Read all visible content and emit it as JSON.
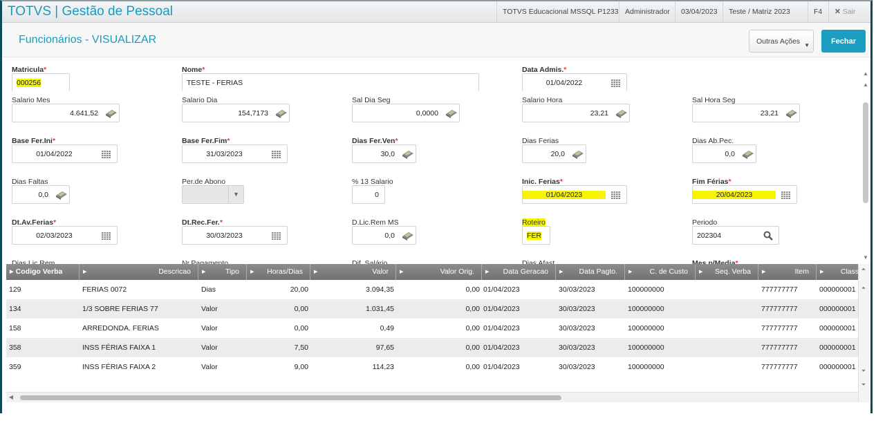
{
  "app": {
    "title": "TOTVS | Gestão de Pessoal",
    "environment": "TOTVS Educacional MSSQL P1233",
    "user": "Administrador",
    "date": "03/04/2023",
    "company": "Teste / Matriz 2023",
    "shortcut": "F4",
    "exit_label": "Sair"
  },
  "page": {
    "title": "Funcionários - VISUALIZAR",
    "other_actions": "Outras Ações",
    "close": "Fechar"
  },
  "fields": [
    {
      "label": "Matricula",
      "required": true,
      "value": "000256",
      "type": "txt",
      "highlight": true
    },
    {
      "label": "Nome",
      "required": true,
      "value": "TESTE - FERIAS",
      "type": "txt"
    },
    {
      "label": "Data Admis.",
      "required": true,
      "value": "01/04/2022",
      "type": "date"
    },
    {
      "label": "Salario Mes",
      "value": "4.641,52",
      "type": "num"
    },
    {
      "label": "Salario Dia",
      "value": "154,7173",
      "type": "num"
    },
    {
      "label": "Sal Dia Seg",
      "value": "0,0000",
      "type": "num"
    },
    {
      "label": "Salario Hora",
      "value": "23,21",
      "type": "num"
    },
    {
      "label": "Sal Hora Seg",
      "value": "23,21",
      "type": "num"
    },
    {
      "label": "Base Fer.Ini",
      "required": true,
      "value": "01/04/2022",
      "type": "date"
    },
    {
      "label": "Base Fer.Fim",
      "required": true,
      "value": "31/03/2023",
      "type": "date"
    },
    {
      "label": "Dias Fer.Ven",
      "required": true,
      "value": "30,0",
      "type": "num"
    },
    {
      "label": "Dias Ferias",
      "value": "20,0",
      "type": "num"
    },
    {
      "label": "Dias Ab.Pec.",
      "value": "0,0",
      "type": "num"
    },
    {
      "label": "Dias Faltas",
      "value": "0,0",
      "type": "num"
    },
    {
      "label": "Per.de Abono",
      "value": "",
      "type": "select",
      "disabled": true
    },
    {
      "label": "% 13 Salario",
      "value": "0",
      "type": "plain"
    },
    {
      "label": "Inic. Ferias",
      "required": true,
      "value": "01/04/2023",
      "type": "date",
      "highlight": true
    },
    {
      "label": "Fim Férias",
      "required": true,
      "value": "20/04/2023",
      "type": "date",
      "highlight": true
    },
    {
      "label": "Dt.Av.Ferias",
      "required": true,
      "value": "02/03/2023",
      "type": "date"
    },
    {
      "label": "Dt.Rec.Fer.",
      "required": true,
      "value": "30/03/2023",
      "type": "date"
    },
    {
      "label": "D.Lic.Rem MS",
      "value": "0,0",
      "type": "num"
    },
    {
      "label": "Roteiro",
      "value": "FER",
      "type": "txt",
      "highlight": true,
      "label_highlight": true
    },
    {
      "label": "Periodo",
      "value": "202304",
      "type": "search"
    }
  ],
  "partial_labels": [
    {
      "label": "Dias Lic.Rem"
    },
    {
      "label": "Nr.Pagamento"
    },
    {
      "label": "Dif. Salário"
    },
    {
      "label": "Dias Afast"
    },
    {
      "label": "Mes p/Media",
      "required": true
    }
  ],
  "grid": {
    "columns": [
      "Codigo Verba",
      "Descricao",
      "Tipo",
      "Horas/Dias",
      "Valor",
      "Valor Orig.",
      "Data Geracao",
      "Data Pagto.",
      "C. de Custo",
      "Seq. Verba",
      "Item",
      "Classe"
    ],
    "rows": [
      [
        "129",
        "FERIAS 0072",
        "Dias",
        "20,00",
        "3.094,35",
        "0,00",
        "01/04/2023",
        "30/03/2023",
        "100000000",
        "",
        "777777777",
        "000000001"
      ],
      [
        "134",
        "1/3 SOBRE FERIAS 77",
        "Valor",
        "0,00",
        "1.031,45",
        "0,00",
        "01/04/2023",
        "30/03/2023",
        "100000000",
        "",
        "777777777",
        "000000001"
      ],
      [
        "158",
        "ARREDONDA. FERIAS",
        "Valor",
        "0,00",
        "0,49",
        "0,00",
        "01/04/2023",
        "30/03/2023",
        "100000000",
        "",
        "777777777",
        "000000001"
      ],
      [
        "358",
        "INSS FÉRIAS FAIXA 1",
        "Valor",
        "7,50",
        "97,65",
        "0,00",
        "01/04/2023",
        "30/03/2023",
        "100000000",
        "",
        "777777777",
        "000000001"
      ],
      [
        "359",
        "INSS FÉRIAS FAIXA 2",
        "Valor",
        "9,00",
        "114,23",
        "0,00",
        "01/04/2023",
        "30/03/2023",
        "100000000",
        "",
        "777777777",
        "000000001"
      ]
    ]
  },
  "colors": {
    "accent": "#1a9bbd",
    "highlight": "#f6f400",
    "required": "#e23a3a"
  }
}
